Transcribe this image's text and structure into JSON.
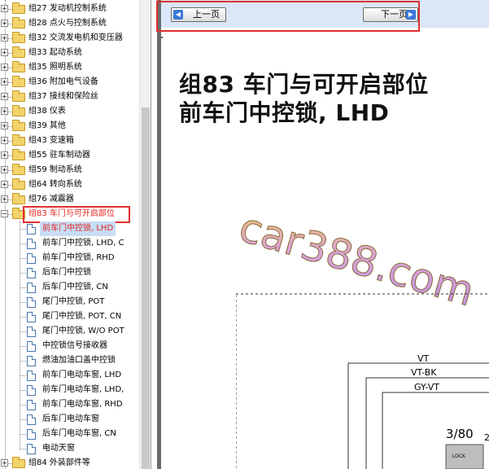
{
  "tree": {
    "groups_before": [
      {
        "label": "组27 发动机控制系统",
        "expand": "+"
      },
      {
        "label": "组28 点火与控制系统",
        "expand": "+"
      },
      {
        "label": "组32 交流发电机和变压器",
        "expand": "+"
      },
      {
        "label": "组33 起动系统",
        "expand": "+"
      },
      {
        "label": "组35 照明系统",
        "expand": "+"
      },
      {
        "label": "组36 附加电气设备",
        "expand": "+"
      },
      {
        "label": "组37 接线和保险丝",
        "expand": "+"
      },
      {
        "label": "组38 仪表",
        "expand": "+"
      },
      {
        "label": "组39 其他",
        "expand": "+"
      },
      {
        "label": "组43 变速箱",
        "expand": "+"
      },
      {
        "label": "组55 驻车制动器",
        "expand": "+"
      },
      {
        "label": "组59 制动系统",
        "expand": "+"
      },
      {
        "label": "组64 转向系统",
        "expand": "+"
      },
      {
        "label": "组76 减震器",
        "expand": "+"
      }
    ],
    "open_group": {
      "label": "组83 车门与可开启部位",
      "expand": "−"
    },
    "children": [
      {
        "label": "前车门中控锁, LHD",
        "selected": true
      },
      {
        "label": "前车门中控锁, LHD, C"
      },
      {
        "label": "前车门中控锁, RHD"
      },
      {
        "label": "后车门中控锁"
      },
      {
        "label": "后车门中控锁, CN"
      },
      {
        "label": "尾门中控锁, POT"
      },
      {
        "label": "尾门中控锁, POT, CN"
      },
      {
        "label": "尾门中控锁, W/O POT"
      },
      {
        "label": "中控锁信号接收器"
      },
      {
        "label": "燃油加油口盖中控锁"
      },
      {
        "label": "前车门电动车窗, LHD"
      },
      {
        "label": "前车门电动车窗, LHD,"
      },
      {
        "label": "前车门电动车窗, RHD"
      },
      {
        "label": "后车门电动车窗"
      },
      {
        "label": "后车门电动车窗, CN"
      },
      {
        "label": "电动天窗"
      }
    ],
    "groups_after": [
      {
        "label": "组84 外装部件等",
        "expand": "+"
      }
    ]
  },
  "viewer": {
    "prev_label": "上一页",
    "next_label": "下一页",
    "title_line1": "组83 车门与可开启部位",
    "title_line2": "前车门中控锁, LHD",
    "watermark": "car388.com",
    "circuit": {
      "wire1": "VT",
      "wire2": "VT-BK",
      "wire3": "GY-VT",
      "ref": "3/80",
      "pin": "2",
      "component": "LOCK"
    }
  },
  "colors": {
    "highlight_red": "#e03030",
    "nav_bg": "#dbe7f8",
    "folder_yellow": "#f3d36b",
    "selection_bg": "#c8dcf4"
  }
}
